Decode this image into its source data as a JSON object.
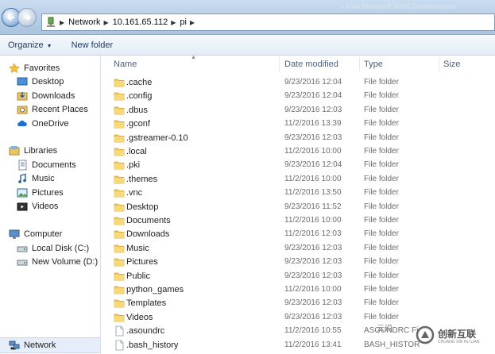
{
  "address": {
    "crumbs": [
      "Network",
      "10.161.65.112",
      "pi"
    ],
    "faded_text": "- Kavi Microsoft Word Documentuen"
  },
  "toolbar": {
    "organize_label": "Organize",
    "new_folder_label": "New folder"
  },
  "sidebar": {
    "favorites": {
      "label": "Favorites",
      "items": [
        "Desktop",
        "Downloads",
        "Recent Places",
        "OneDrive"
      ]
    },
    "libraries": {
      "label": "Libraries",
      "items": [
        "Documents",
        "Music",
        "Pictures",
        "Videos"
      ]
    },
    "computer": {
      "label": "Computer",
      "items": [
        "Local Disk (C:)",
        "New Volume (D:)"
      ]
    },
    "network": {
      "label": "Network"
    }
  },
  "columns": {
    "name": "Name",
    "date": "Date modified",
    "type": "Type",
    "size": "Size"
  },
  "files": [
    {
      "name": ".cache",
      "date": "9/23/2016 12:04",
      "type": "File folder",
      "kind": "folder"
    },
    {
      "name": ".config",
      "date": "9/23/2016 12:04",
      "type": "File folder",
      "kind": "folder"
    },
    {
      "name": ".dbus",
      "date": "9/23/2016 12:03",
      "type": "File folder",
      "kind": "folder"
    },
    {
      "name": ".gconf",
      "date": "11/2/2016 13:39",
      "type": "File folder",
      "kind": "folder"
    },
    {
      "name": ".gstreamer-0.10",
      "date": "9/23/2016 12:03",
      "type": "File folder",
      "kind": "folder"
    },
    {
      "name": ".local",
      "date": "11/2/2016 10:00",
      "type": "File folder",
      "kind": "folder"
    },
    {
      "name": ".pki",
      "date": "9/23/2016 12:04",
      "type": "File folder",
      "kind": "folder"
    },
    {
      "name": ".themes",
      "date": "11/2/2016 10:00",
      "type": "File folder",
      "kind": "folder"
    },
    {
      "name": ".vnc",
      "date": "11/2/2016 13:50",
      "type": "File folder",
      "kind": "folder"
    },
    {
      "name": "Desktop",
      "date": "9/23/2016 11:52",
      "type": "File folder",
      "kind": "folder"
    },
    {
      "name": "Documents",
      "date": "11/2/2016 10:00",
      "type": "File folder",
      "kind": "folder"
    },
    {
      "name": "Downloads",
      "date": "11/2/2016 12:03",
      "type": "File folder",
      "kind": "folder"
    },
    {
      "name": "Music",
      "date": "9/23/2016 12:03",
      "type": "File folder",
      "kind": "folder"
    },
    {
      "name": "Pictures",
      "date": "9/23/2016 12:03",
      "type": "File folder",
      "kind": "folder"
    },
    {
      "name": "Public",
      "date": "9/23/2016 12:03",
      "type": "File folder",
      "kind": "folder"
    },
    {
      "name": "python_games",
      "date": "11/2/2016 10:00",
      "type": "File folder",
      "kind": "folder"
    },
    {
      "name": "Templates",
      "date": "9/23/2016 12:03",
      "type": "File folder",
      "kind": "folder"
    },
    {
      "name": "Videos",
      "date": "9/23/2016 12:03",
      "type": "File folder",
      "kind": "folder"
    },
    {
      "name": ".asoundrc",
      "date": "11/2/2016 10:55",
      "type": "ASOUNDRC Fi",
      "kind": "file"
    },
    {
      "name": ".bash_history",
      "date": "11/2/2016 13:41",
      "type": "BASH_HISTOR",
      "kind": "file"
    }
  ],
  "watermark": {
    "top_text": "云说",
    "brand": "创新互联",
    "sub": "CHUANG XIN HU LIAN"
  },
  "colors": {
    "accent": "#1e395b",
    "folder": "#f2c75c",
    "selection": "#e5eef8"
  }
}
